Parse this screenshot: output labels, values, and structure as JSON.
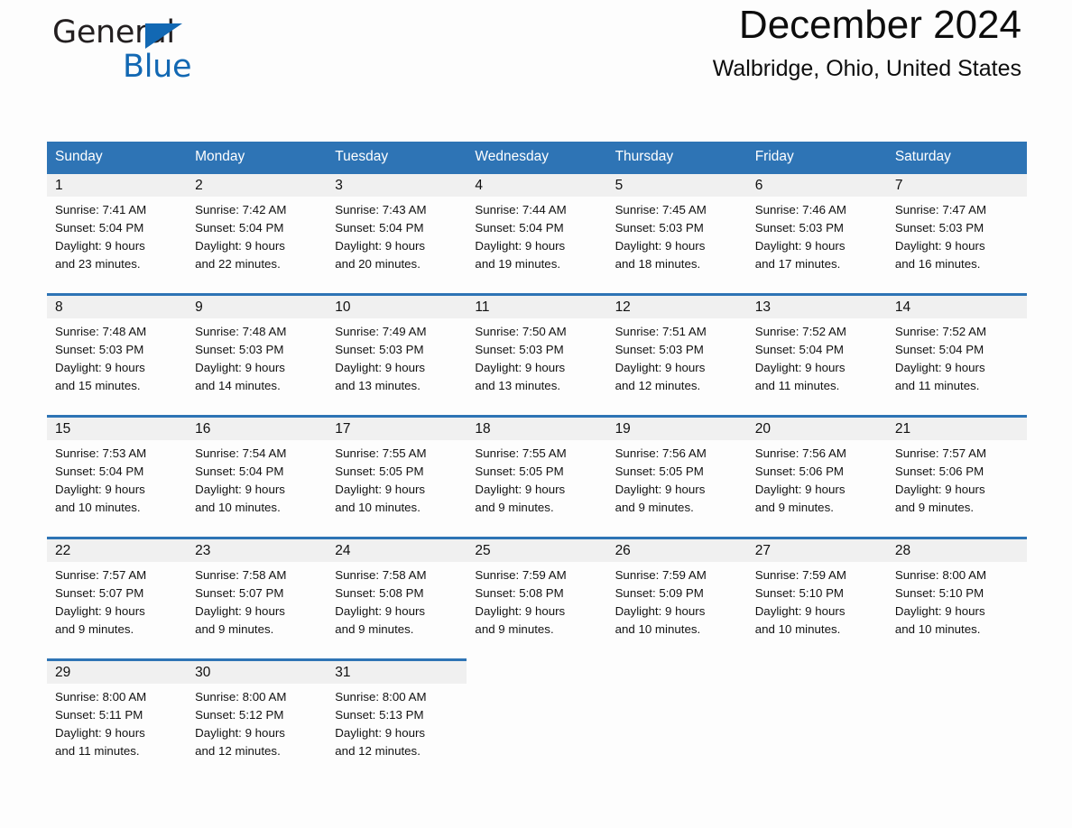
{
  "brand": {
    "name_dark": "General",
    "name_blue": "Blue",
    "triangle_color": "#1268b3"
  },
  "header": {
    "month_title": "December 2024",
    "location": "Walbridge, Ohio, United States"
  },
  "theme": {
    "header_blue": "#2e74b5",
    "daynum_band": "#f0f0f0",
    "page_background": "#fdfdfd"
  },
  "weekdays": [
    "Sunday",
    "Monday",
    "Tuesday",
    "Wednesday",
    "Thursday",
    "Friday",
    "Saturday"
  ],
  "weeks": [
    [
      {
        "day": "1",
        "sunrise": "Sunrise: 7:41 AM",
        "sunset": "Sunset: 5:04 PM",
        "daylight1": "Daylight: 9 hours",
        "daylight2": "and 23 minutes."
      },
      {
        "day": "2",
        "sunrise": "Sunrise: 7:42 AM",
        "sunset": "Sunset: 5:04 PM",
        "daylight1": "Daylight: 9 hours",
        "daylight2": "and 22 minutes."
      },
      {
        "day": "3",
        "sunrise": "Sunrise: 7:43 AM",
        "sunset": "Sunset: 5:04 PM",
        "daylight1": "Daylight: 9 hours",
        "daylight2": "and 20 minutes."
      },
      {
        "day": "4",
        "sunrise": "Sunrise: 7:44 AM",
        "sunset": "Sunset: 5:04 PM",
        "daylight1": "Daylight: 9 hours",
        "daylight2": "and 19 minutes."
      },
      {
        "day": "5",
        "sunrise": "Sunrise: 7:45 AM",
        "sunset": "Sunset: 5:03 PM",
        "daylight1": "Daylight: 9 hours",
        "daylight2": "and 18 minutes."
      },
      {
        "day": "6",
        "sunrise": "Sunrise: 7:46 AM",
        "sunset": "Sunset: 5:03 PM",
        "daylight1": "Daylight: 9 hours",
        "daylight2": "and 17 minutes."
      },
      {
        "day": "7",
        "sunrise": "Sunrise: 7:47 AM",
        "sunset": "Sunset: 5:03 PM",
        "daylight1": "Daylight: 9 hours",
        "daylight2": "and 16 minutes."
      }
    ],
    [
      {
        "day": "8",
        "sunrise": "Sunrise: 7:48 AM",
        "sunset": "Sunset: 5:03 PM",
        "daylight1": "Daylight: 9 hours",
        "daylight2": "and 15 minutes."
      },
      {
        "day": "9",
        "sunrise": "Sunrise: 7:48 AM",
        "sunset": "Sunset: 5:03 PM",
        "daylight1": "Daylight: 9 hours",
        "daylight2": "and 14 minutes."
      },
      {
        "day": "10",
        "sunrise": "Sunrise: 7:49 AM",
        "sunset": "Sunset: 5:03 PM",
        "daylight1": "Daylight: 9 hours",
        "daylight2": "and 13 minutes."
      },
      {
        "day": "11",
        "sunrise": "Sunrise: 7:50 AM",
        "sunset": "Sunset: 5:03 PM",
        "daylight1": "Daylight: 9 hours",
        "daylight2": "and 13 minutes."
      },
      {
        "day": "12",
        "sunrise": "Sunrise: 7:51 AM",
        "sunset": "Sunset: 5:03 PM",
        "daylight1": "Daylight: 9 hours",
        "daylight2": "and 12 minutes."
      },
      {
        "day": "13",
        "sunrise": "Sunrise: 7:52 AM",
        "sunset": "Sunset: 5:04 PM",
        "daylight1": "Daylight: 9 hours",
        "daylight2": "and 11 minutes."
      },
      {
        "day": "14",
        "sunrise": "Sunrise: 7:52 AM",
        "sunset": "Sunset: 5:04 PM",
        "daylight1": "Daylight: 9 hours",
        "daylight2": "and 11 minutes."
      }
    ],
    [
      {
        "day": "15",
        "sunrise": "Sunrise: 7:53 AM",
        "sunset": "Sunset: 5:04 PM",
        "daylight1": "Daylight: 9 hours",
        "daylight2": "and 10 minutes."
      },
      {
        "day": "16",
        "sunrise": "Sunrise: 7:54 AM",
        "sunset": "Sunset: 5:04 PM",
        "daylight1": "Daylight: 9 hours",
        "daylight2": "and 10 minutes."
      },
      {
        "day": "17",
        "sunrise": "Sunrise: 7:55 AM",
        "sunset": "Sunset: 5:05 PM",
        "daylight1": "Daylight: 9 hours",
        "daylight2": "and 10 minutes."
      },
      {
        "day": "18",
        "sunrise": "Sunrise: 7:55 AM",
        "sunset": "Sunset: 5:05 PM",
        "daylight1": "Daylight: 9 hours",
        "daylight2": "and 9 minutes."
      },
      {
        "day": "19",
        "sunrise": "Sunrise: 7:56 AM",
        "sunset": "Sunset: 5:05 PM",
        "daylight1": "Daylight: 9 hours",
        "daylight2": "and 9 minutes."
      },
      {
        "day": "20",
        "sunrise": "Sunrise: 7:56 AM",
        "sunset": "Sunset: 5:06 PM",
        "daylight1": "Daylight: 9 hours",
        "daylight2": "and 9 minutes."
      },
      {
        "day": "21",
        "sunrise": "Sunrise: 7:57 AM",
        "sunset": "Sunset: 5:06 PM",
        "daylight1": "Daylight: 9 hours",
        "daylight2": "and 9 minutes."
      }
    ],
    [
      {
        "day": "22",
        "sunrise": "Sunrise: 7:57 AM",
        "sunset": "Sunset: 5:07 PM",
        "daylight1": "Daylight: 9 hours",
        "daylight2": "and 9 minutes."
      },
      {
        "day": "23",
        "sunrise": "Sunrise: 7:58 AM",
        "sunset": "Sunset: 5:07 PM",
        "daylight1": "Daylight: 9 hours",
        "daylight2": "and 9 minutes."
      },
      {
        "day": "24",
        "sunrise": "Sunrise: 7:58 AM",
        "sunset": "Sunset: 5:08 PM",
        "daylight1": "Daylight: 9 hours",
        "daylight2": "and 9 minutes."
      },
      {
        "day": "25",
        "sunrise": "Sunrise: 7:59 AM",
        "sunset": "Sunset: 5:08 PM",
        "daylight1": "Daylight: 9 hours",
        "daylight2": "and 9 minutes."
      },
      {
        "day": "26",
        "sunrise": "Sunrise: 7:59 AM",
        "sunset": "Sunset: 5:09 PM",
        "daylight1": "Daylight: 9 hours",
        "daylight2": "and 10 minutes."
      },
      {
        "day": "27",
        "sunrise": "Sunrise: 7:59 AM",
        "sunset": "Sunset: 5:10 PM",
        "daylight1": "Daylight: 9 hours",
        "daylight2": "and 10 minutes."
      },
      {
        "day": "28",
        "sunrise": "Sunrise: 8:00 AM",
        "sunset": "Sunset: 5:10 PM",
        "daylight1": "Daylight: 9 hours",
        "daylight2": "and 10 minutes."
      }
    ],
    [
      {
        "day": "29",
        "sunrise": "Sunrise: 8:00 AM",
        "sunset": "Sunset: 5:11 PM",
        "daylight1": "Daylight: 9 hours",
        "daylight2": "and 11 minutes."
      },
      {
        "day": "30",
        "sunrise": "Sunrise: 8:00 AM",
        "sunset": "Sunset: 5:12 PM",
        "daylight1": "Daylight: 9 hours",
        "daylight2": "and 12 minutes."
      },
      {
        "day": "31",
        "sunrise": "Sunrise: 8:00 AM",
        "sunset": "Sunset: 5:13 PM",
        "daylight1": "Daylight: 9 hours",
        "daylight2": "and 12 minutes."
      },
      {
        "day": "",
        "sunrise": "",
        "sunset": "",
        "daylight1": "",
        "daylight2": ""
      },
      {
        "day": "",
        "sunrise": "",
        "sunset": "",
        "daylight1": "",
        "daylight2": ""
      },
      {
        "day": "",
        "sunrise": "",
        "sunset": "",
        "daylight1": "",
        "daylight2": ""
      },
      {
        "day": "",
        "sunrise": "",
        "sunset": "",
        "daylight1": "",
        "daylight2": ""
      }
    ]
  ]
}
